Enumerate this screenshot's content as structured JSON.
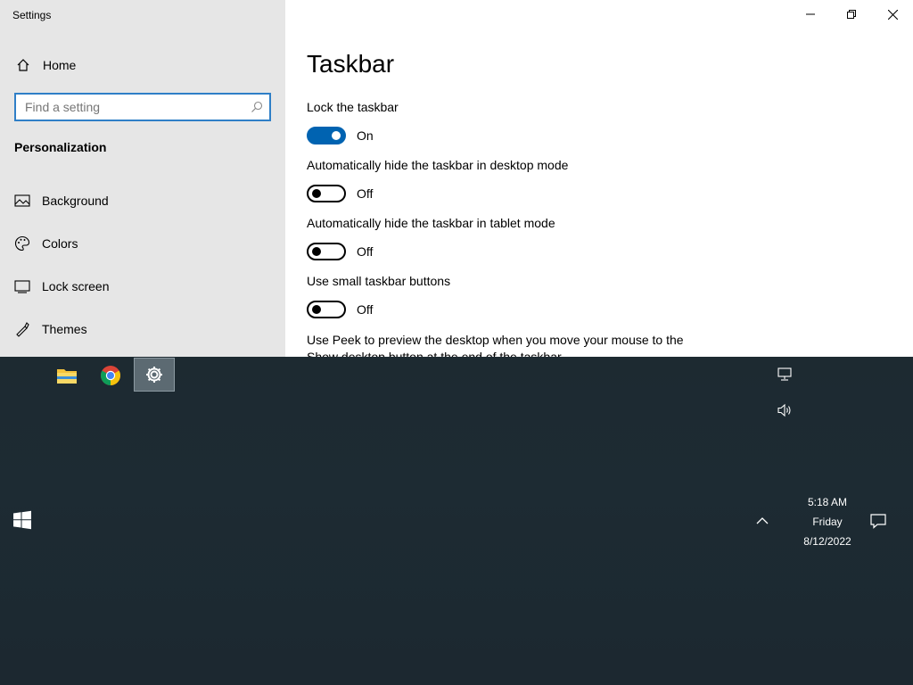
{
  "app": {
    "title": "Settings"
  },
  "sidebar": {
    "home_label": "Home",
    "search_placeholder": "Find a setting",
    "section_label": "Personalization",
    "items": [
      {
        "label": "Background",
        "icon": "picture-icon"
      },
      {
        "label": "Colors",
        "icon": "palette-icon"
      },
      {
        "label": "Lock screen",
        "icon": "lock-screen-icon"
      },
      {
        "label": "Themes",
        "icon": "themes-icon"
      }
    ]
  },
  "main": {
    "title": "Taskbar",
    "settings": [
      {
        "label": "Lock the taskbar",
        "state": "On",
        "on": true
      },
      {
        "label": "Automatically hide the taskbar in desktop mode",
        "state": "Off",
        "on": false
      },
      {
        "label": "Automatically hide the taskbar in tablet mode",
        "state": "Off",
        "on": false
      },
      {
        "label": "Use small taskbar buttons",
        "state": "Off",
        "on": false
      }
    ],
    "peek_label": "Use Peek to preview the desktop when you move your mouse to the Show desktop button at the end of the taskbar"
  },
  "taskbar": {
    "apps": [
      {
        "name": "file-explorer-icon"
      },
      {
        "name": "chrome-icon"
      },
      {
        "name": "settings-gear-icon",
        "active": true
      }
    ],
    "clock": {
      "time": "5:18 AM",
      "day": "Friday",
      "date": "8/12/2022"
    }
  },
  "colors": {
    "accent": "#0063b1",
    "sidebar_bg": "#e6e6e6",
    "taskbar_bg": "#1d2a31"
  }
}
